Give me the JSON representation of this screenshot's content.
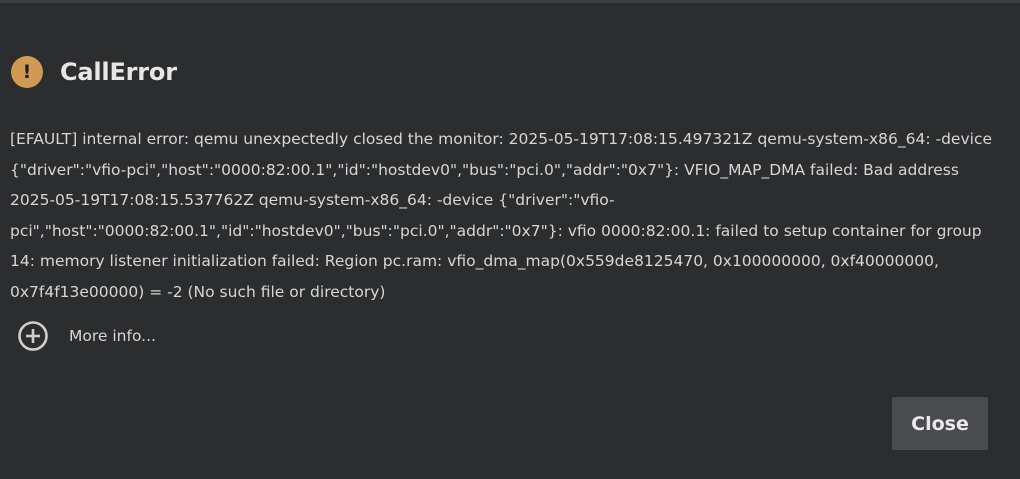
{
  "dialog": {
    "title": "CallError",
    "icon": "warning-circle-icon",
    "icon_color": "#d09a52",
    "message": "[EFAULT] internal error: qemu unexpectedly closed the monitor: 2025-05-19T17:08:15.497321Z qemu-system-x86_64: -device {\"driver\":\"vfio-pci\",\"host\":\"0000:82:00.1\",\"id\":\"hostdev0\",\"bus\":\"pci.0\",\"addr\":\"0x7\"}: VFIO_MAP_DMA failed: Bad address 2025-05-19T17:08:15.537762Z qemu-system-x86_64: -device {\"driver\":\"vfio-pci\",\"host\":\"0000:82:00.1\",\"id\":\"hostdev0\",\"bus\":\"pci.0\",\"addr\":\"0x7\"}: vfio 0000:82:00.1: failed to setup container for group 14: memory listener initialization failed: Region pc.ram: vfio_dma_map(0x559de8125470, 0x100000000, 0xf40000000, 0x7f4f13e00000) = -2 (No such file or directory)",
    "more_info_label": "More info...",
    "more_info_icon": "plus-circle-icon",
    "close_label": "Close"
  },
  "colors": {
    "background": "#2c2d2f",
    "text": "#d6d6d6",
    "button_background": "#4a4b4e"
  }
}
